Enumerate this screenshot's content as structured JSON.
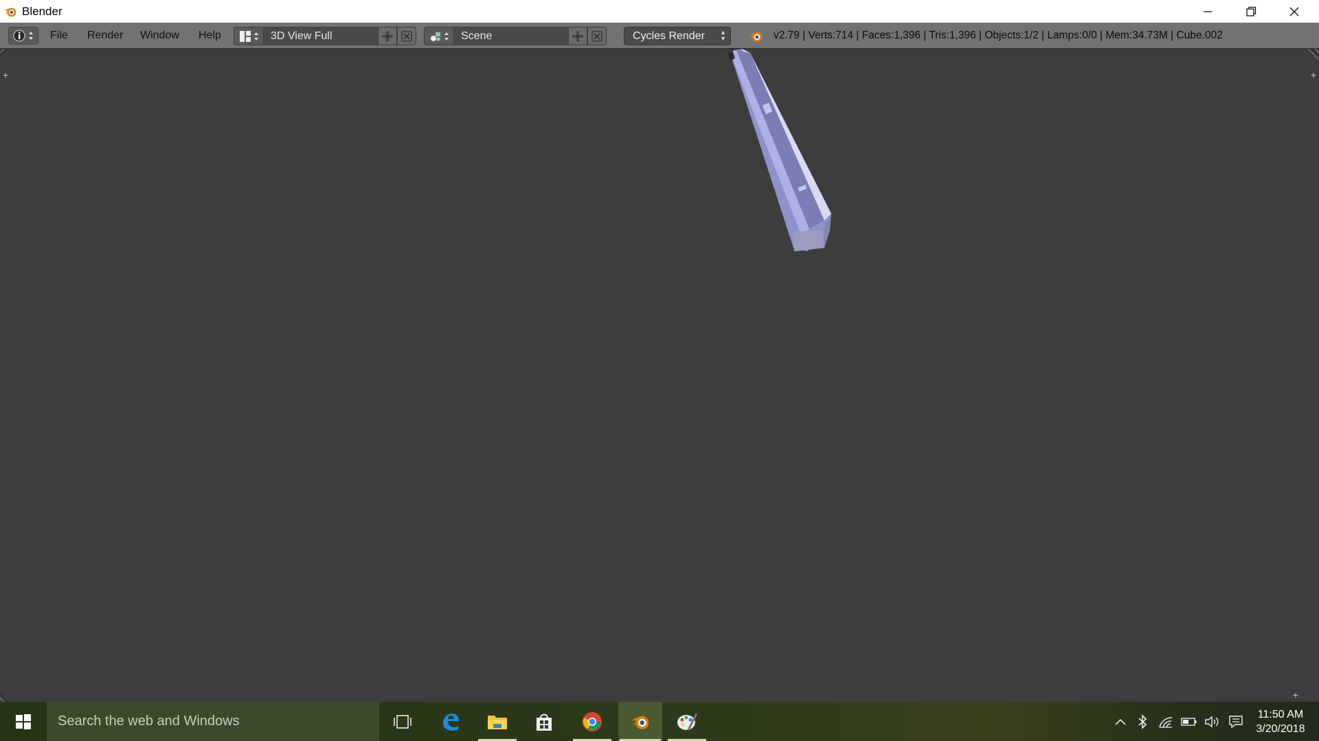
{
  "window": {
    "title": "Blender",
    "controls": {
      "minimize": "minimize-icon",
      "restore": "restore-icon",
      "close": "close-icon"
    }
  },
  "header": {
    "menus": [
      "File",
      "Render",
      "Window",
      "Help"
    ],
    "screen_layout": "3D View Full",
    "scene": "Scene",
    "render_engine": "Cycles Render",
    "stats": "v2.79 | Verts:714 | Faces:1,396 | Tris:1,396 | Objects:1/2 | Lamps:0/0 | Mem:34.73M | Cube.002"
  },
  "viewport": {
    "background_color": "#3d3d3d",
    "object_color": "#a9abe0",
    "object_name": "Cube.002"
  },
  "taskbar": {
    "search_placeholder": "Search the web and Windows",
    "apps": [
      "task-view-icon",
      "edge-icon",
      "file-explorer-icon",
      "store-icon",
      "chrome-icon",
      "blender-icon",
      "paint-icon"
    ],
    "tray": [
      "chevron-up-icon",
      "bluetooth-icon",
      "wifi-icon",
      "battery-icon",
      "volume-icon",
      "action-center-icon"
    ],
    "time": "11:50 AM",
    "date": "3/20/2018"
  },
  "colors": {
    "header_bg": "#727272",
    "title_bg": "#ffffff",
    "taskbar_bg": "#2c3a1a",
    "blender_orange": "#e87d0d",
    "blender_blue": "#265787"
  }
}
